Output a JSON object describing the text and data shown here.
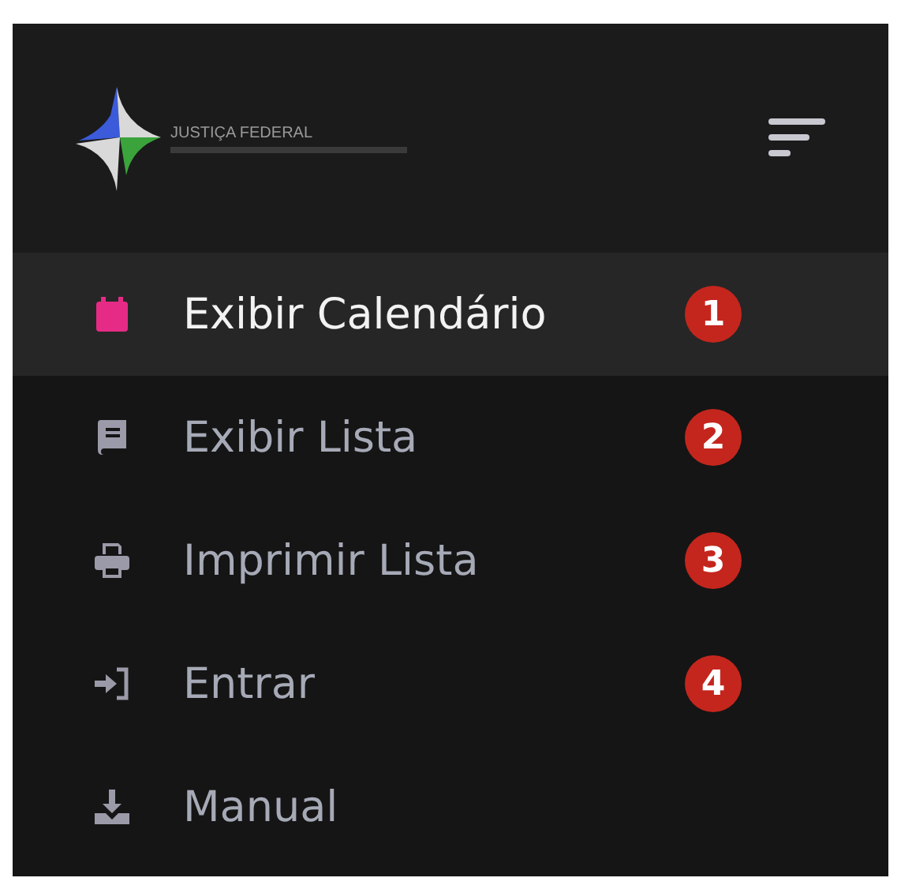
{
  "logo": {
    "title": "JUSTIÇA FEDERAL"
  },
  "menu": [
    {
      "label": "Exibir Calendário",
      "selected": true,
      "badge": "1"
    },
    {
      "label": "Exibir Lista",
      "selected": false,
      "badge": "2"
    },
    {
      "label": "Imprimir Lista",
      "selected": false,
      "badge": "3"
    },
    {
      "label": "Entrar",
      "selected": false,
      "badge": "4"
    },
    {
      "label": "Manual",
      "selected": false
    }
  ]
}
